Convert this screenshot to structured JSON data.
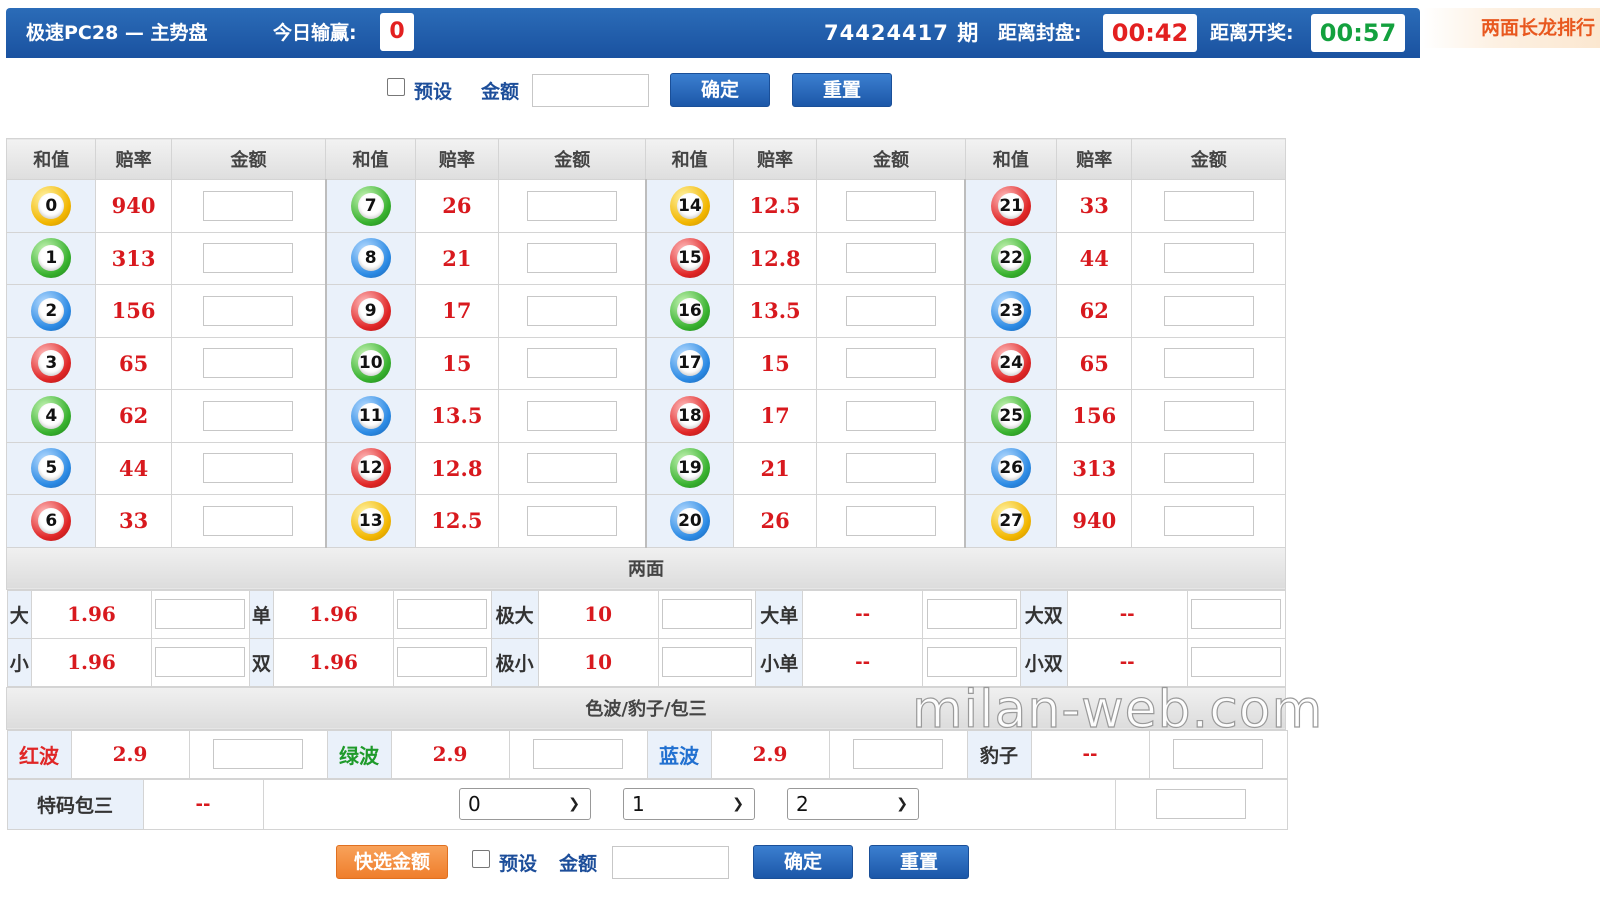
{
  "header": {
    "title": "极速PC28 — 主势盘",
    "today_label": "今日输赢:",
    "today_value": "0",
    "issue": "74424417 期",
    "close_label": "距离封盘:",
    "close_time": "00:42",
    "open_label": "距离开奖:",
    "open_time": "00:57",
    "side_tag": "两面长龙排行"
  },
  "betbar_top": {
    "preset_label": "预设",
    "amount_label": "金额",
    "confirm": "确定",
    "reset": "重置"
  },
  "betbar_bottom": {
    "quick_amount": "快选金额",
    "preset_label": "预设",
    "amount_label": "金额",
    "confirm": "确定",
    "reset": "重置"
  },
  "table_headers": [
    "和值",
    "赔率",
    "金额"
  ],
  "numbers": [
    [
      {
        "n": "0",
        "odds": "940",
        "color": "yellow"
      },
      {
        "n": "7",
        "odds": "26",
        "color": "green"
      },
      {
        "n": "14",
        "odds": "12.5",
        "color": "yellow"
      },
      {
        "n": "21",
        "odds": "33",
        "color": "red"
      }
    ],
    [
      {
        "n": "1",
        "odds": "313",
        "color": "green"
      },
      {
        "n": "8",
        "odds": "21",
        "color": "blue"
      },
      {
        "n": "15",
        "odds": "12.8",
        "color": "red"
      },
      {
        "n": "22",
        "odds": "44",
        "color": "green"
      }
    ],
    [
      {
        "n": "2",
        "odds": "156",
        "color": "blue"
      },
      {
        "n": "9",
        "odds": "17",
        "color": "red"
      },
      {
        "n": "16",
        "odds": "13.5",
        "color": "green"
      },
      {
        "n": "23",
        "odds": "62",
        "color": "blue"
      }
    ],
    [
      {
        "n": "3",
        "odds": "65",
        "color": "red"
      },
      {
        "n": "10",
        "odds": "15",
        "color": "green"
      },
      {
        "n": "17",
        "odds": "15",
        "color": "blue"
      },
      {
        "n": "24",
        "odds": "65",
        "color": "red"
      }
    ],
    [
      {
        "n": "4",
        "odds": "62",
        "color": "green"
      },
      {
        "n": "11",
        "odds": "13.5",
        "color": "blue"
      },
      {
        "n": "18",
        "odds": "17",
        "color": "red"
      },
      {
        "n": "25",
        "odds": "156",
        "color": "green"
      }
    ],
    [
      {
        "n": "5",
        "odds": "44",
        "color": "blue"
      },
      {
        "n": "12",
        "odds": "12.8",
        "color": "red"
      },
      {
        "n": "19",
        "odds": "21",
        "color": "green"
      },
      {
        "n": "26",
        "odds": "313",
        "color": "blue"
      }
    ],
    [
      {
        "n": "6",
        "odds": "33",
        "color": "red"
      },
      {
        "n": "13",
        "odds": "12.5",
        "color": "yellow"
      },
      {
        "n": "20",
        "odds": "26",
        "color": "blue"
      },
      {
        "n": "27",
        "odds": "940",
        "color": "yellow"
      }
    ]
  ],
  "liangmian": {
    "title": "两面",
    "rows": [
      [
        {
          "label": "大",
          "odds": "1.96"
        },
        {
          "label": "单",
          "odds": "1.96"
        },
        {
          "label": "极大",
          "odds": "10"
        },
        {
          "label": "大单",
          "odds": "--"
        },
        {
          "label": "大双",
          "odds": "--"
        }
      ],
      [
        {
          "label": "小",
          "odds": "1.96"
        },
        {
          "label": "双",
          "odds": "1.96"
        },
        {
          "label": "极小",
          "odds": "10"
        },
        {
          "label": "小单",
          "odds": "--"
        },
        {
          "label": "小双",
          "odds": "--"
        }
      ]
    ]
  },
  "sebo": {
    "title": "色波/豹子/包三",
    "items": [
      {
        "label": "红波",
        "odds": "2.9"
      },
      {
        "label": "绿波",
        "odds": "2.9"
      },
      {
        "label": "蓝波",
        "odds": "2.9"
      },
      {
        "label": "豹子",
        "odds": "--"
      }
    ]
  },
  "tema": {
    "label": "特码包三",
    "odds": "--",
    "selects": [
      "0",
      "1",
      "2"
    ]
  },
  "watermark": "milan-web.com",
  "colors": {
    "header_bg": "#1a52a0",
    "odds_red": "#d8191e",
    "countdown_red": "#e32020",
    "countdown_green": "#13a13e",
    "quick_orange": "#ef7e2c"
  }
}
